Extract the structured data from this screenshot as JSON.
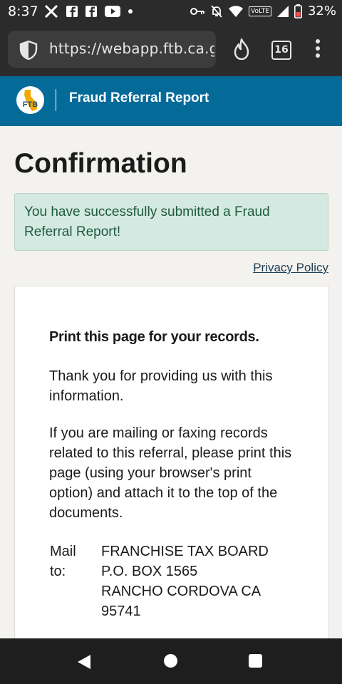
{
  "status_bar": {
    "time": "8:37",
    "battery": "32%",
    "volte": "VoLTE",
    "left_icons": [
      "x-icon",
      "facebook-icon",
      "facebook-icon",
      "youtube-icon",
      "dot-icon"
    ],
    "right_icons": [
      "key-icon",
      "notifications-off-icon",
      "wifi-icon",
      "signal-icon",
      "battery-icon"
    ]
  },
  "browser": {
    "url": "https://webapp.ftb.ca.gov",
    "tab_count": "16"
  },
  "header": {
    "logo_text": "FTB",
    "title": "Fraud Referral Report",
    "background": "#046b99"
  },
  "page": {
    "title": "Confirmation",
    "success_message": "You have successfully submitted a Fraud Referral Report!",
    "privacy_link": "Privacy Policy"
  },
  "card": {
    "heading": "Print this page for your records.",
    "paragraph1": "Thank you for providing us with this information.",
    "paragraph2": "If you are mailing or faxing records related to this referral, please print this page (using your browser's print option) and attach it to the top of the documents.",
    "mail_label": "Mail to:",
    "address": [
      "FRANCHISE TAX BOARD",
      "P.O. BOX 1565",
      "RANCHO CORDOVA CA",
      "95741"
    ]
  }
}
